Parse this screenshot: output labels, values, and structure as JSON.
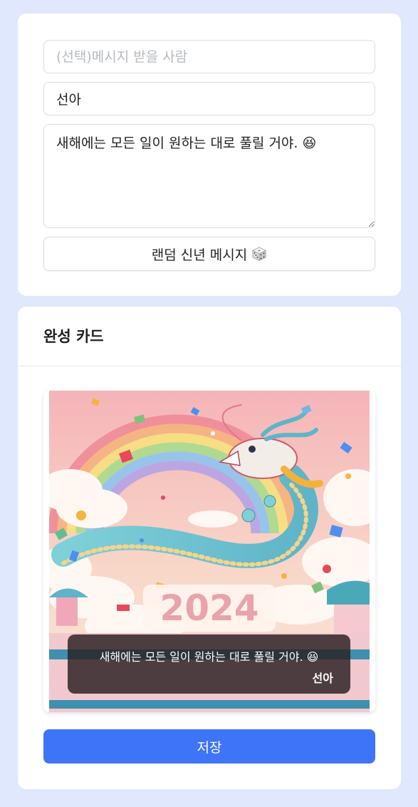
{
  "form": {
    "recipient_placeholder": "(선택)메시지 받을 사람",
    "recipient_value": "",
    "sender_value": "선아",
    "message_value": "새해에는 모든 일이 원하는 대로 풀릴 거야. 😆",
    "random_button_label": "랜덤 신년 메시지",
    "random_button_icon": "dice-icon"
  },
  "result": {
    "title": "완성 카드",
    "illustration_year": "2024",
    "overlay_message": "새해에는 모든 일이 원하는 대로 풀릴 거야. 😆",
    "overlay_sender": "선아",
    "save_label": "저장"
  },
  "colors": {
    "background": "#dfe8fc",
    "primary": "#3e74f8"
  }
}
